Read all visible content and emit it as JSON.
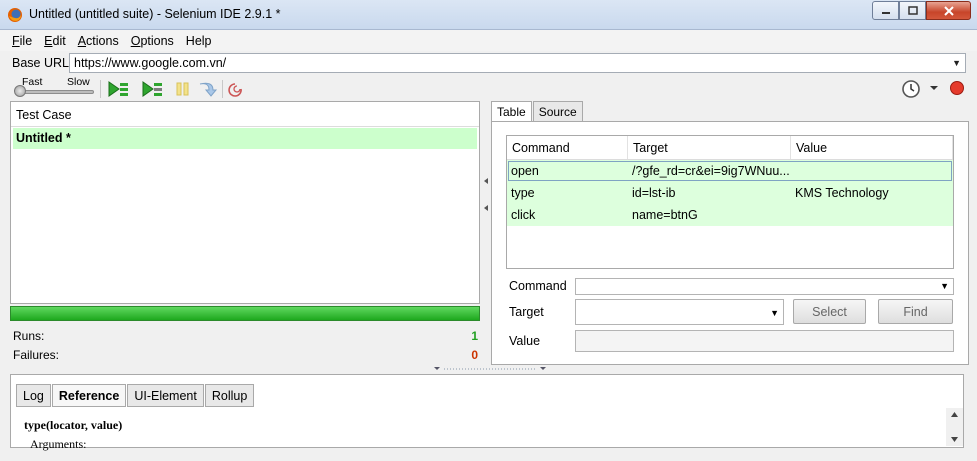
{
  "window": {
    "title": "Untitled (untitled suite) - Selenium IDE 2.9.1 *"
  },
  "menu": [
    {
      "first": "F",
      "rest": "ile"
    },
    {
      "first": "E",
      "rest": "dit"
    },
    {
      "first": "A",
      "rest": "ctions"
    },
    {
      "first": "O",
      "rest": "ptions"
    },
    {
      "first": "",
      "rest": "Help"
    }
  ],
  "base_url": {
    "label": "Base URL",
    "value": "https://www.google.com.vn/"
  },
  "speed": {
    "fast_label": "Fast",
    "slow_label": "Slow",
    "level": 0
  },
  "test_case": {
    "header": "Test Case",
    "items": [
      "Untitled *"
    ]
  },
  "stats": {
    "runs_label": "Runs:",
    "runs": "1",
    "failures_label": "Failures:",
    "failures": "0"
  },
  "editor_tabs": [
    "Table",
    "Source"
  ],
  "table": {
    "headers": [
      "Command",
      "Target",
      "Value"
    ],
    "rows": [
      {
        "command": "open",
        "target": "/?gfe_rd=cr&ei=9ig7WNuu...",
        "value": ""
      },
      {
        "command": "type",
        "target": "id=lst-ib",
        "value": "KMS Technology"
      },
      {
        "command": "click",
        "target": "name=btnG",
        "value": ""
      }
    ]
  },
  "form": {
    "command_label": "Command",
    "target_label": "Target",
    "value_label": "Value",
    "select_button": "Select",
    "find_button": "Find"
  },
  "bottom_tabs": [
    "Log",
    "Reference",
    "UI-Element",
    "Rollup"
  ],
  "reference": {
    "signature": "type(locator, value)",
    "sub": "Arguments:"
  },
  "colors": {
    "pass_green": "#22a022",
    "failure_red": "#cc3300",
    "row_green": "#ddffdd"
  }
}
